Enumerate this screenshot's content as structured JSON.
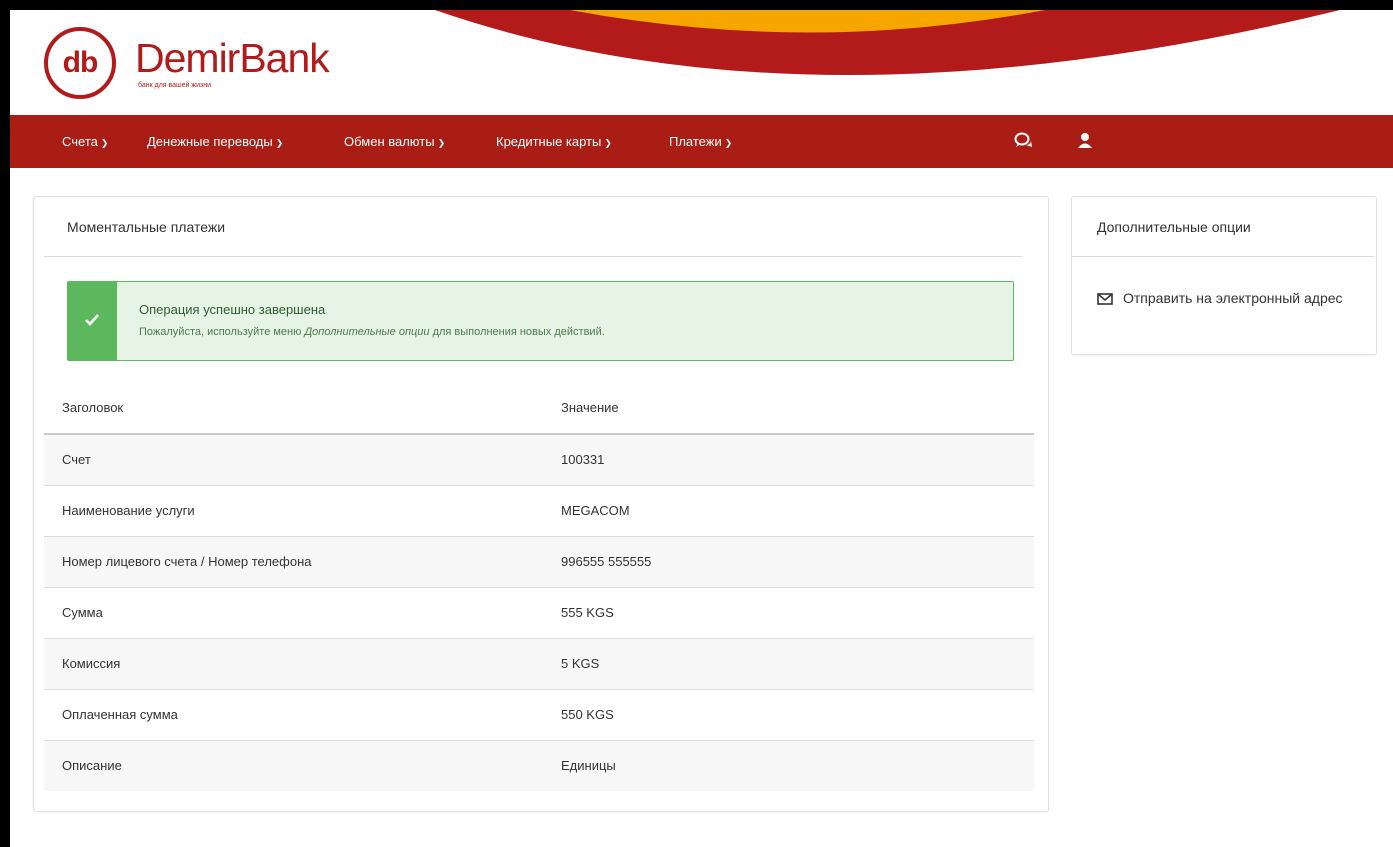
{
  "brand": {
    "logo_mark": "db",
    "name": "DemirBank",
    "slogan": "банк для вашей жизни",
    "color": "#a91d15",
    "arc_colors": [
      "#b31b1b",
      "#f7a600"
    ]
  },
  "nav": {
    "items": [
      {
        "label": "Счета"
      },
      {
        "label": "Денежные переводы"
      },
      {
        "label": "Обмен валюты"
      },
      {
        "label": "Кредитные карты"
      },
      {
        "label": "Платежи"
      }
    ],
    "icons": [
      "chat-icon",
      "user-icon"
    ]
  },
  "main": {
    "title": "Моментальные платежи",
    "alert": {
      "icon": "check-icon",
      "color": "#5cb85c",
      "title": "Операция успешно завершена",
      "text_before": "Пожалуйста, используйте меню ",
      "text_italic": "Дополнительные опции",
      "text_after": " для выполнения новых действий."
    },
    "table": {
      "headers": [
        "Заголовок",
        "Значение"
      ],
      "rows": [
        {
          "label": "Счет",
          "value": "100331"
        },
        {
          "label": "Наименование услуги",
          "value": "MEGACOM"
        },
        {
          "label": "Номер лицевого счета / Номер телефона",
          "value": "996555 555555"
        },
        {
          "label": "Сумма",
          "value": "555 KGS"
        },
        {
          "label": "Комиссия",
          "value": "5 KGS"
        },
        {
          "label": "Оплаченная сумма",
          "value": "550 KGS"
        },
        {
          "label": "Описание",
          "value": "Единицы"
        }
      ]
    }
  },
  "sidebar": {
    "title": "Дополнительные опции",
    "items": [
      {
        "icon": "mail-icon",
        "label": "Отправить на электронный адрес"
      }
    ]
  }
}
